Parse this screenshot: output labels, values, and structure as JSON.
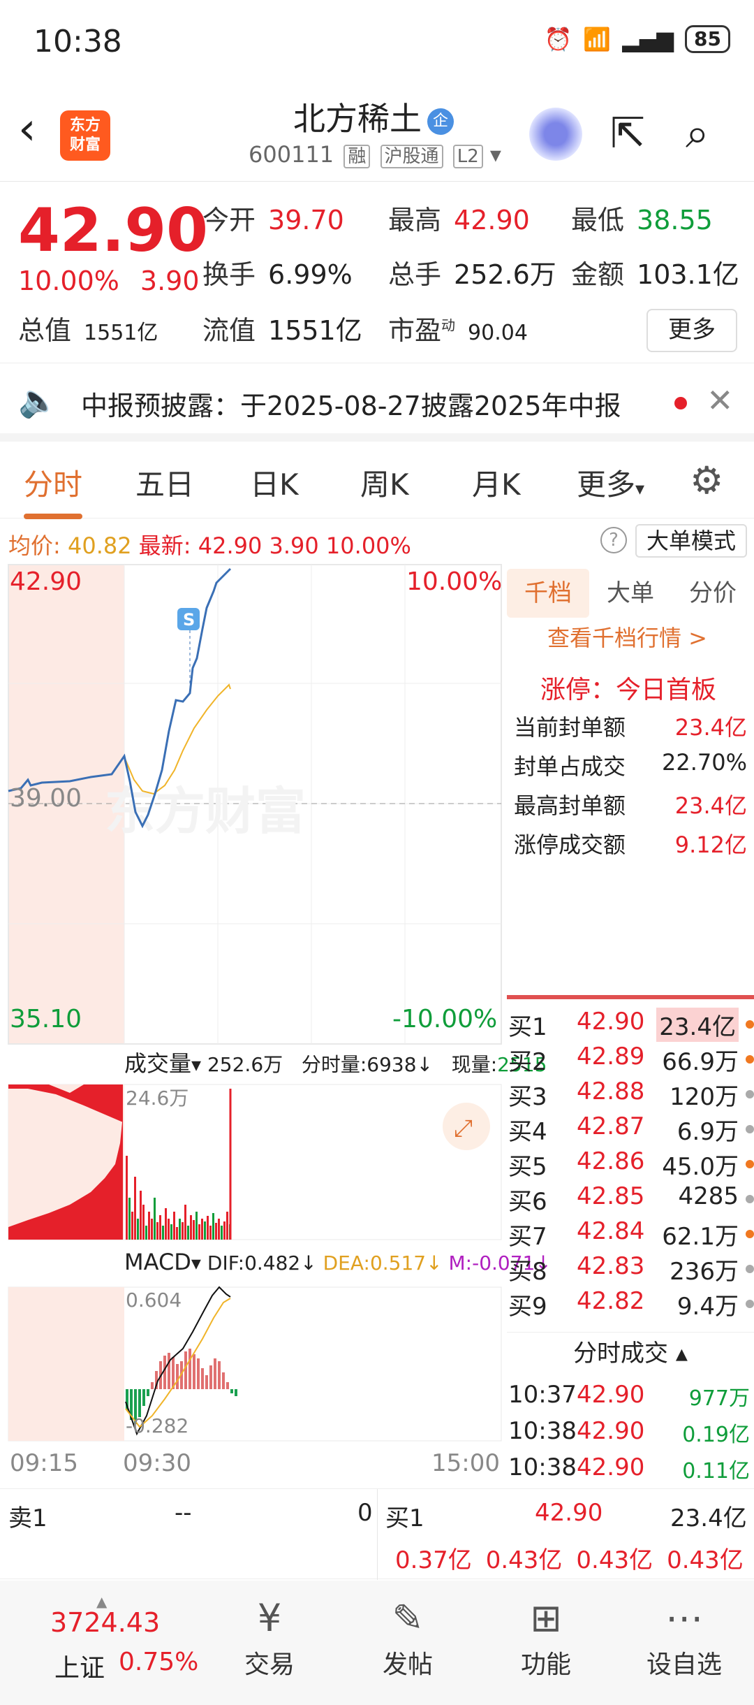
{
  "status": {
    "time": "10:38",
    "battery": "85",
    "network": "6"
  },
  "header": {
    "logo_text_1": "东方",
    "logo_text_2": "财富",
    "title": "北方稀土",
    "verified": "企",
    "code": "600111",
    "tags": [
      "融",
      "沪股通",
      "L2"
    ]
  },
  "quote": {
    "price": "42.90",
    "change_pct": "10.00%",
    "change": "3.90",
    "open_label": "今开",
    "open": "39.70",
    "high_label": "最高",
    "high": "42.90",
    "low_label": "最低",
    "low": "38.55",
    "turnover_label": "换手",
    "turnover": "6.99%",
    "volume_label": "总手",
    "volume": "252.6万",
    "amount_label": "金额",
    "amount": "103.1亿",
    "mktcap_label": "总值",
    "mktcap": "1551亿",
    "float_label": "流值",
    "float": "1551亿",
    "pe_label": "市盈",
    "pe_sup": "动",
    "pe": "90.04",
    "more": "更多"
  },
  "notice": {
    "text": "中报预披露：于2025-08-27披露2025年中报"
  },
  "tabs": [
    "分时",
    "五日",
    "日K",
    "周K",
    "月K",
    "更多"
  ],
  "avg_row": {
    "avg_label": "均价:",
    "avg": "40.82",
    "latest_label": "最新:",
    "latest": "42.90",
    "chg": "3.90",
    "pct": "10.00%",
    "mode": "大单模式"
  },
  "chart_labels": {
    "top_price": "42.90",
    "top_pct": "10.00%",
    "mid_price": "39.00",
    "bottom_price": "35.10",
    "bottom_pct": "-10.00%",
    "s_marker": "S",
    "vol_title": "成交量",
    "vol_total": "252.6万",
    "vol_tick_label": "分时量:6938",
    "vol_now_label": "现量:",
    "vol_now": "2515",
    "vol_max": "24.6万",
    "macd_title": "MACD",
    "dif": "DIF:0.482",
    "dea": "DEA:0.517",
    "m": "M:-0.071",
    "macd_max": "0.604",
    "macd_min": "-0.282",
    "t_start": "09:15",
    "t_open": "09:30",
    "t_end": "15:00",
    "watermark": "东方财富"
  },
  "panel": {
    "tabs": [
      "千档",
      "大单",
      "分价"
    ],
    "link": "查看千档行情 >",
    "limit_up": "涨停：今日首板",
    "rows": [
      {
        "label": "当前封单额",
        "value": "23.4亿"
      },
      {
        "label": "封单占成交",
        "value": "22.70%"
      },
      {
        "label": "最高封单额",
        "value": "23.4亿"
      },
      {
        "label": "涨停成交额",
        "value": "9.12亿"
      }
    ],
    "book": [
      {
        "name": "买1",
        "price": "42.90",
        "vol": "23.4亿"
      },
      {
        "name": "买2",
        "price": "42.89",
        "vol": "66.9万"
      },
      {
        "name": "买3",
        "price": "42.88",
        "vol": "120万"
      },
      {
        "name": "买4",
        "price": "42.87",
        "vol": "6.9万"
      },
      {
        "name": "买5",
        "price": "42.86",
        "vol": "45.0万"
      },
      {
        "name": "买6",
        "price": "42.85",
        "vol": "4285"
      },
      {
        "name": "买7",
        "price": "42.84",
        "vol": "62.1万"
      },
      {
        "name": "买8",
        "price": "42.83",
        "vol": "236万"
      },
      {
        "name": "买9",
        "price": "42.82",
        "vol": "9.4万"
      }
    ],
    "tick_header": "分时成交",
    "ticks": [
      {
        "time": "10:37",
        "price": "42.90",
        "vol": "977万"
      },
      {
        "time": "10:38",
        "price": "42.90",
        "vol": "0.19亿"
      },
      {
        "time": "10:38",
        "price": "42.90",
        "vol": "0.11亿"
      }
    ]
  },
  "bottom_quote": {
    "sell_label": "卖1",
    "sell_price": "--",
    "sell_vol": "0",
    "buy_label": "买1",
    "buy_price": "42.90",
    "buy_vol": "23.4亿",
    "seal_values": [
      "0.37亿",
      "0.43亿",
      "0.43亿",
      "0.43亿"
    ]
  },
  "tabbar": {
    "index_value": "3724.43",
    "index_name": "上证",
    "index_chg": "0.75%",
    "items": [
      "交易",
      "发帖",
      "功能",
      "设自选"
    ]
  },
  "colors": {
    "up": "#e5202a",
    "down": "#0f9d3a",
    "accent": "#e07030",
    "price_line": "#3a6fb5",
    "avg_line": "#f0b429"
  }
}
